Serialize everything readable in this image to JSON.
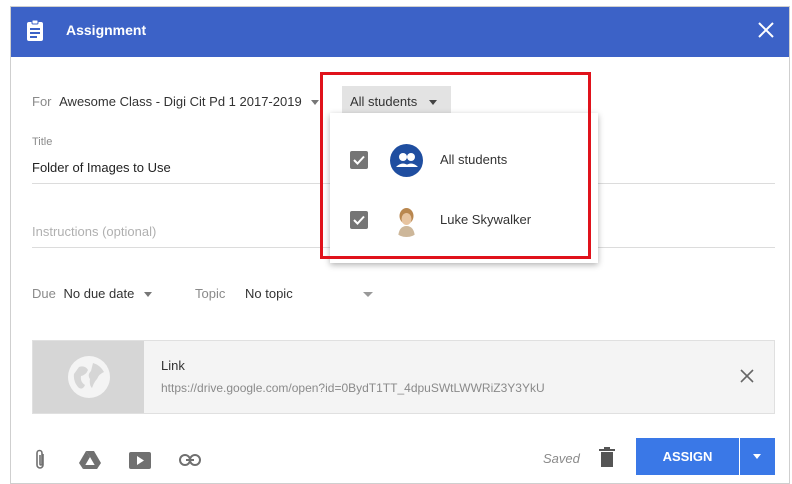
{
  "header": {
    "title": "Assignment",
    "bg_color": "#3c62c7",
    "icons": [
      "assignment-doc-icon",
      "close-icon"
    ]
  },
  "for_row": {
    "label": "For",
    "class_name": "Awesome Class - Digi Cit Pd 1 2017-2019"
  },
  "students_dropdown": {
    "selected": "All students",
    "options": [
      {
        "label": "All students",
        "checked": true,
        "icon": "group-icon"
      },
      {
        "label": "Luke Skywalker",
        "checked": true,
        "icon": "student-avatar"
      }
    ]
  },
  "title_field": {
    "label": "Title",
    "value": "Folder of Images to Use"
  },
  "instructions_field": {
    "placeholder": "Instructions (optional)"
  },
  "due": {
    "label": "Due",
    "value": "No due date"
  },
  "topic": {
    "label": "Topic",
    "value": "No topic"
  },
  "attachment": {
    "title": "Link",
    "url": "https://drive.google.com/open?id=0BydT1TT_4dpuSWtLWWRiZ3Y3YkU",
    "icon": "globe-icon"
  },
  "footer": {
    "icons": [
      "paperclip-icon",
      "drive-icon",
      "youtube-icon",
      "link-icon"
    ],
    "saved_label": "Saved",
    "assign_label": "ASSIGN",
    "accent_color": "#3a78e7"
  },
  "annotation": {
    "color": "#e0121b"
  }
}
